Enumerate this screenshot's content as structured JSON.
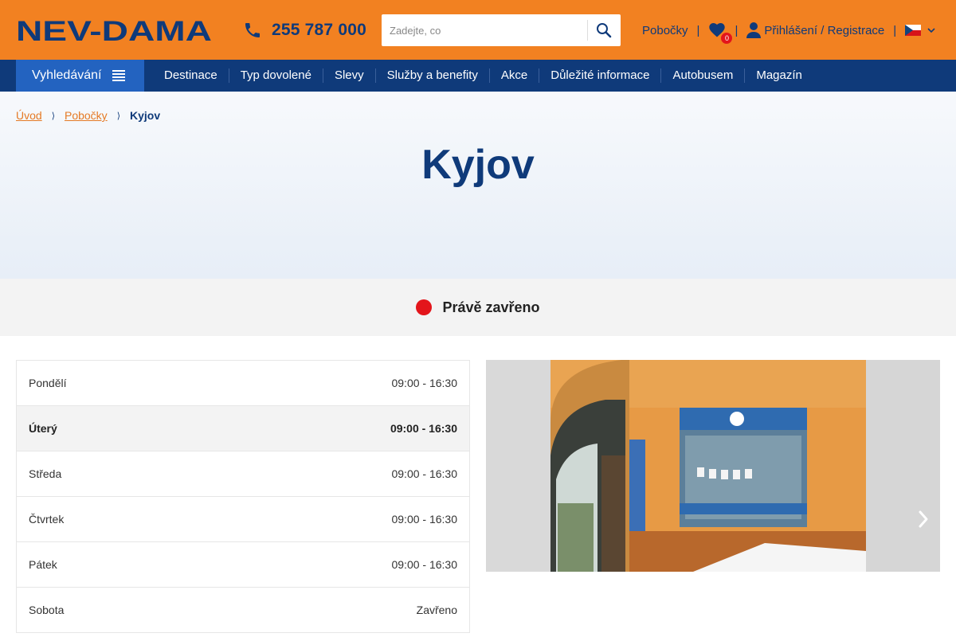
{
  "brand": {
    "logo_text": "NEV-DAMA",
    "primary": "#f28121",
    "navy": "#0f3a7a"
  },
  "header": {
    "phone": "255 787 000",
    "search_placeholder": "Zadejte, co",
    "branches_label": "Pobočky",
    "favorites_count": "0",
    "login_label": "Přihlášení / Registrace",
    "language": "cs"
  },
  "nav": {
    "search_label": "Vyhledávání",
    "items": [
      "Destinace",
      "Typ dovolené",
      "Slevy",
      "Služby a benefity",
      "Akce",
      "Důležité informace",
      "Autobusem",
      "Magazín"
    ]
  },
  "breadcrumb": {
    "home": "Úvod",
    "branches": "Pobočky",
    "current": "Kyjov"
  },
  "page": {
    "title": "Kyjov"
  },
  "status": {
    "text": "Právě zavřeno",
    "color": "#e3151b"
  },
  "hours": [
    {
      "day": "Pondělí",
      "time": "09:00 - 16:30"
    },
    {
      "day": "Úterý",
      "time": "09:00 - 16:30",
      "today": true
    },
    {
      "day": "Středa",
      "time": "09:00 - 16:30"
    },
    {
      "day": "Čtvrtek",
      "time": "09:00 - 16:30"
    },
    {
      "day": "Pátek",
      "time": "09:00 - 16:30"
    },
    {
      "day": "Sobota",
      "time": "Zavřeno"
    }
  ]
}
